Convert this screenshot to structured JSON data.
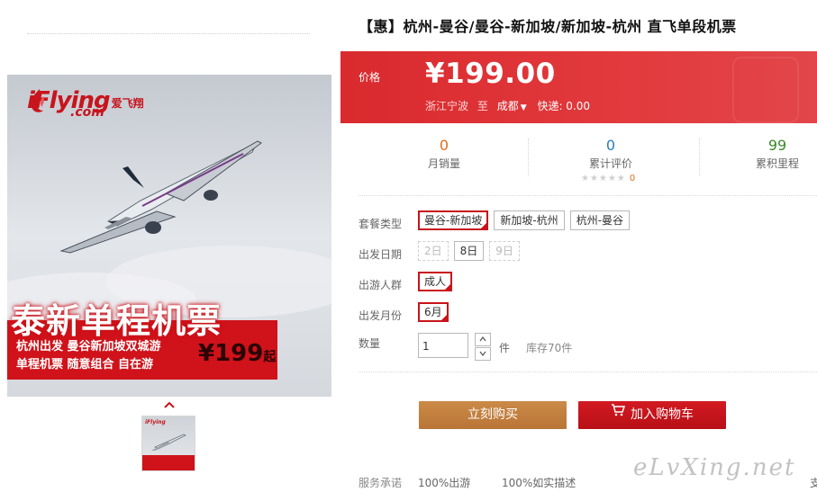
{
  "product": {
    "title": "【惠】杭州-曼谷/曼谷-新加坡/新加坡-杭州 直飞单段机票"
  },
  "image": {
    "logo_text": "iFlying",
    "logo_sub": "爱飞翔",
    "logo_com": ".com",
    "banner_title": "泰新单程机票",
    "banner_line1": "杭州出发 曼谷新加坡双城游",
    "banner_line2": "单程机票 随意组合 自在游",
    "banner_price": "¥199",
    "banner_price_suffix": "起"
  },
  "price": {
    "label": "价格",
    "value": "¥199.00"
  },
  "shipping": {
    "from": "浙江宁波",
    "to_word": "至",
    "destination": "成都",
    "fee": "快递: 0.00"
  },
  "stats": {
    "monthly_sales": "0",
    "monthly_sales_label": "月销量",
    "reviews": "0",
    "reviews_label": "累计评价",
    "review_count": "0",
    "miles": "99",
    "miles_label": "累积里程"
  },
  "options": {
    "package_label": "套餐类型",
    "packages": [
      "曼谷-新加坡",
      "新加坡-杭州",
      "杭州-曼谷"
    ],
    "date_label": "出发日期",
    "dates": [
      "2日",
      "8日",
      "9日"
    ],
    "traveler_label": "出游人群",
    "traveler": "成人",
    "month_label": "出发月份",
    "month": "6月",
    "qty_label": "数量",
    "qty_value": "1",
    "qty_unit": "件",
    "stock": "库存70件"
  },
  "actions": {
    "buy_now": "立刻购买",
    "add_to_cart": "加入购物车"
  },
  "service": {
    "label": "服务承诺",
    "items": [
      "100%出游",
      "100%如实描述",
      "支"
    ]
  },
  "watermark": "eLvXing.net",
  "colors": {
    "price_bg": "#e4393c",
    "buy_btn": "#c28040",
    "cart_btn": "#c4121a",
    "selected_border": "#c8141c"
  }
}
